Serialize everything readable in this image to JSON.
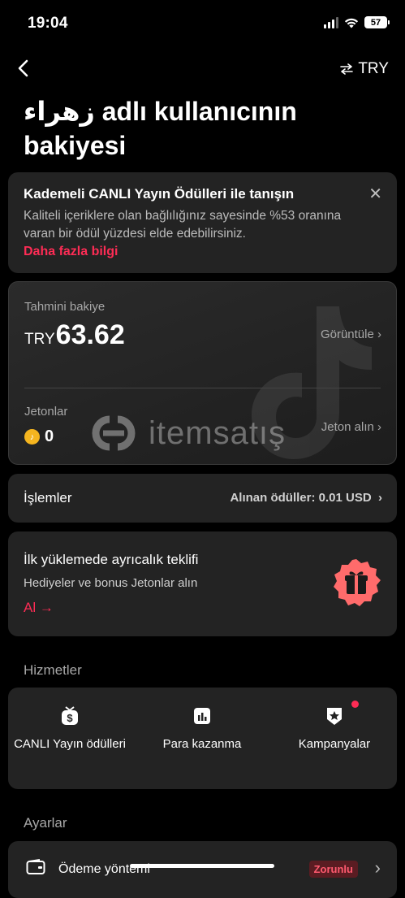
{
  "status": {
    "time": "19:04",
    "battery": "57"
  },
  "header": {
    "currency": "TRY",
    "title": "زهراء adlı kullanıcının bakiyesi"
  },
  "promo": {
    "title": "Kademeli CANLI Yayın Ödülleri ile tanışın",
    "text": "Kaliteli içeriklere olan bağlılığınız sayesinde %53 oranına varan bir ödül yüzdesi elde edebilirsiniz.",
    "link": "Daha fazla bilgi"
  },
  "balance": {
    "label": "Tahmini bakiye",
    "currency": "TRY",
    "amount": "63.62",
    "view": "Görüntüle",
    "coins_label": "Jetonlar",
    "coins": "0",
    "get_coins": "Jeton alın",
    "watermark": "itemsatış"
  },
  "transactions": {
    "title": "İşlemler",
    "rewards": "Alınan ödüller: 0.01 USD"
  },
  "offer": {
    "title": "İlk yüklemede ayrıcalık teklifi",
    "subtitle": "Hediyeler ve bonus Jetonlar alın",
    "cta": "Al →"
  },
  "services": {
    "heading": "Hizmetler",
    "items": [
      {
        "label": "CANLI Yayın ödülleri",
        "icon": "live-reward-icon"
      },
      {
        "label": "Para kazanma",
        "icon": "earnings-chart-icon"
      },
      {
        "label": "Kampanyalar",
        "icon": "campaign-badge-icon"
      }
    ]
  },
  "settings": {
    "heading": "Ayarlar",
    "payment": {
      "label": "Ödeme yöntemi",
      "badge": "Zorunlu",
      "icon": "wallet-icon"
    }
  },
  "colors": {
    "accent": "#fe2c55",
    "card": "#232323",
    "coin": "#f5b51f"
  }
}
